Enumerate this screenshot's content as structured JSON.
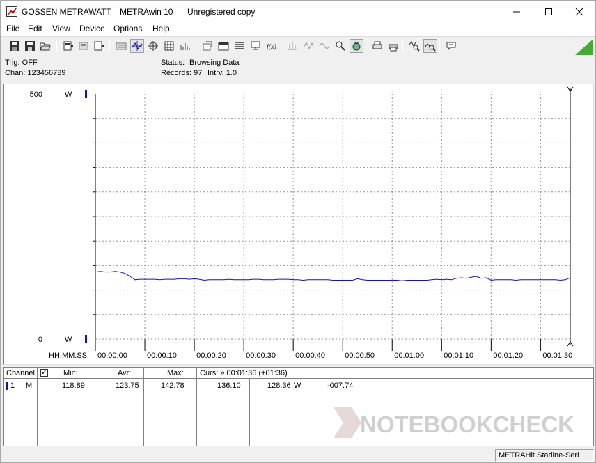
{
  "window": {
    "brand": "GOSSEN METRAWATT",
    "app_name": "METRAwin 10",
    "license": "Unregistered copy"
  },
  "menu": [
    "File",
    "Edit",
    "View",
    "Device",
    "Options",
    "Help"
  ],
  "info": {
    "trig": "Trig: OFF",
    "chan": "Chan:  123456789",
    "status_label": "Status:",
    "status_value": "Browsing Data",
    "records": "Records: 97",
    "interval": "Intrv. 1.0"
  },
  "chart_data": {
    "type": "line",
    "y_unit": "W",
    "x_axis_label": "HH:MM:SS",
    "ylim": [
      0,
      500
    ],
    "y_tick_labels": [
      "500",
      "0"
    ],
    "x_ticks": [
      "00:00:00",
      "00:00:10",
      "00:00:20",
      "00:00:30",
      "00:00:40",
      "00:00:50",
      "00:01:00",
      "00:01:10",
      "00:01:20",
      "00:01:30"
    ],
    "xlim_seconds": [
      0,
      96
    ],
    "grid": true,
    "cursor_seconds": 96,
    "series": [
      {
        "color": "#1010c8",
        "x": [
          0,
          1,
          2,
          3,
          4,
          5,
          6,
          7,
          8,
          9,
          10,
          11,
          12,
          13,
          14,
          15,
          16,
          17,
          18,
          19,
          20,
          21,
          22,
          23,
          24,
          25,
          26,
          27,
          28,
          29,
          30,
          31,
          32,
          33,
          34,
          35,
          36,
          37,
          38,
          39,
          40,
          41,
          42,
          43,
          44,
          45,
          46,
          47,
          48,
          49,
          50,
          51,
          52,
          53,
          54,
          55,
          56,
          57,
          58,
          59,
          60,
          61,
          62,
          63,
          64,
          65,
          66,
          67,
          68,
          69,
          70,
          71,
          72,
          73,
          74,
          75,
          76,
          77,
          78,
          79,
          80,
          81,
          82,
          83,
          84,
          85,
          86,
          87,
          88,
          89,
          90,
          91,
          92,
          93,
          94,
          95,
          96
        ],
        "y": [
          137,
          138,
          137,
          137,
          138,
          137,
          134,
          128,
          121,
          122,
          122,
          122,
          122,
          121,
          122,
          122,
          122,
          123,
          123,
          122,
          123,
          122,
          120,
          121,
          121,
          121,
          121,
          122,
          121,
          121,
          121,
          121,
          122,
          122,
          121,
          121,
          121,
          122,
          122,
          122,
          121,
          121,
          120,
          121,
          121,
          121,
          121,
          121,
          120,
          120,
          120,
          120,
          120,
          123,
          121,
          120,
          120,
          120,
          120,
          120,
          120,
          120,
          119,
          120,
          120,
          120,
          120,
          120,
          121,
          122,
          121,
          122,
          121,
          124,
          125,
          124,
          126,
          128,
          124,
          125,
          120,
          121,
          121,
          121,
          121,
          120,
          121,
          121,
          121,
          121,
          121,
          121,
          121,
          121,
          120,
          121,
          125
        ]
      }
    ]
  },
  "table": {
    "headers": {
      "channel": "Channel:",
      "min": "Min:",
      "avr": "Avr:",
      "max": "Max:",
      "curs": "Curs: » 00:01:36 (+01:36)"
    },
    "row": {
      "num": "1",
      "mode": "M",
      "min": "118.89",
      "avr": "123.75",
      "max": "142.78",
      "curs_a": "136.10",
      "curs_b": "128.36",
      "unit": "W",
      "delta": "-007.74"
    }
  },
  "statusbar": {
    "device": "METRAHit Starline-Seri"
  },
  "watermark": {
    "text": "NOTEBOOKCHECK"
  },
  "icons": [
    "app-icon",
    "minimize-icon",
    "maximize-icon",
    "close-icon",
    "save-icon",
    "save-as-icon",
    "open-icon",
    "device-icon",
    "print-icon",
    "zoom-icon",
    "signal-meter-icon"
  ],
  "colors": {
    "trace": "#1010c8",
    "accent_green": "#44aa33",
    "grid": "#909090"
  }
}
